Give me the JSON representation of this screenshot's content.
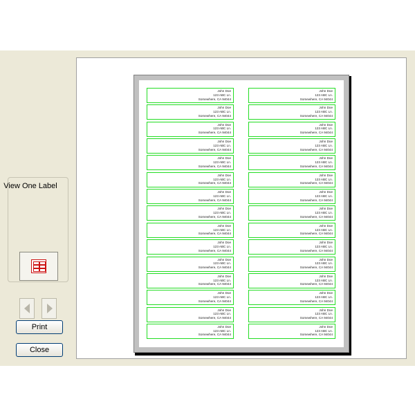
{
  "sidebar": {
    "view_label": "View One Label",
    "grid_icon": "label-grid-icon",
    "prev_icon": "arrow-left-icon",
    "next_icon": "arrow-right-icon"
  },
  "buttons": {
    "print": "Print",
    "close": "Close"
  },
  "label_text": {
    "name": "John Doe",
    "street": "123 ABC Ln.",
    "city_line": "Somewhere, CA 94044"
  },
  "layout": {
    "columns": 2,
    "rows": 15
  },
  "colors": {
    "label_border": "#22dd22",
    "dialog_background": "#ece9d8",
    "grid_icon": "#cc1111"
  }
}
